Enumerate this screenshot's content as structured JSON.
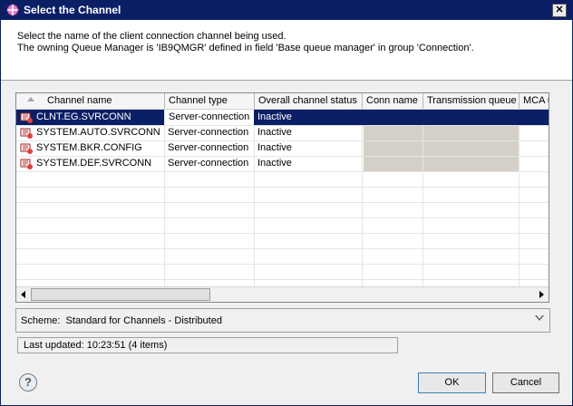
{
  "window": {
    "title": "Select the Channel",
    "close_glyph": "✕"
  },
  "messages": {
    "line1": "Select the name of the client connection channel being used.",
    "line2": "The owning Queue Manager is 'IB9QMGR' defined in field 'Base queue manager' in group 'Connection'."
  },
  "table": {
    "columns": [
      "Channel name",
      "Channel type",
      "Overall channel status",
      "Conn name",
      "Transmission queue",
      "MCA u"
    ],
    "rows": [
      {
        "name": "CLNT.EG.SVRCONN",
        "type": "Server-connection",
        "status": "Inactive",
        "selected": true
      },
      {
        "name": "SYSTEM.AUTO.SVRCONN",
        "type": "Server-connection",
        "status": "Inactive",
        "selected": false
      },
      {
        "name": "SYSTEM.BKR.CONFIG",
        "type": "Server-connection",
        "status": "Inactive",
        "selected": false
      },
      {
        "name": "SYSTEM.DEF.SVRCONN",
        "type": "Server-connection",
        "status": "Inactive",
        "selected": false
      }
    ]
  },
  "scheme": {
    "label": "Scheme:",
    "value": "Standard for Channels - Distributed"
  },
  "status": {
    "text": "Last updated: 10:23:51 (4 items)"
  },
  "buttons": {
    "help": "?",
    "ok": "OK",
    "cancel": "Cancel"
  },
  "colors": {
    "title_bar": "#0b1f66",
    "selection": "#0b1f66",
    "disabled_cell": "#d4d0c8"
  }
}
